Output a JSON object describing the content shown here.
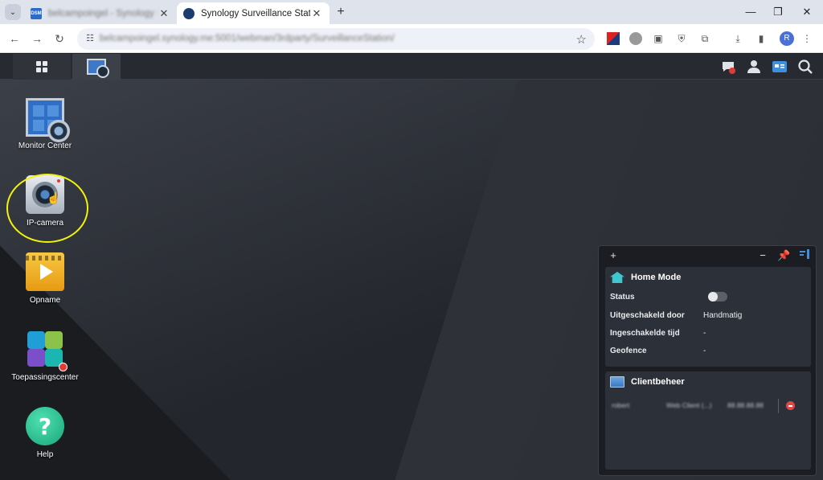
{
  "browser": {
    "tabs": [
      {
        "title": "belcampoingel - Synology DSM",
        "active": false
      },
      {
        "title": "Synology Surveillance Station",
        "active": true
      }
    ],
    "url": "belcampoingel.synology.me:5001/webman/3rdparty/SurveillanceStation/",
    "avatar_letter": "R"
  },
  "desktop": {
    "icons": [
      {
        "label": "Monitor Center"
      },
      {
        "label": "IP-camera"
      },
      {
        "label": "Opname"
      },
      {
        "label": "Toepassingscenter"
      },
      {
        "label": "Help"
      }
    ]
  },
  "widgets": {
    "home_mode": {
      "title": "Home Mode",
      "rows": [
        {
          "key": "Status",
          "value": ""
        },
        {
          "key": "Uitgeschakeld door",
          "value": "Handmatig"
        },
        {
          "key": "Ingeschakelde tijd",
          "value": "-"
        },
        {
          "key": "Geofence",
          "value": "-"
        }
      ]
    },
    "client": {
      "title": "Clientbeheer",
      "row": {
        "user": "robert",
        "client": "Web Client (...)",
        "address": "88.88.88.88"
      }
    }
  },
  "colors": {
    "highlight": "#f2f20c",
    "accent": "#3fc6cf",
    "danger": "#e04848"
  }
}
